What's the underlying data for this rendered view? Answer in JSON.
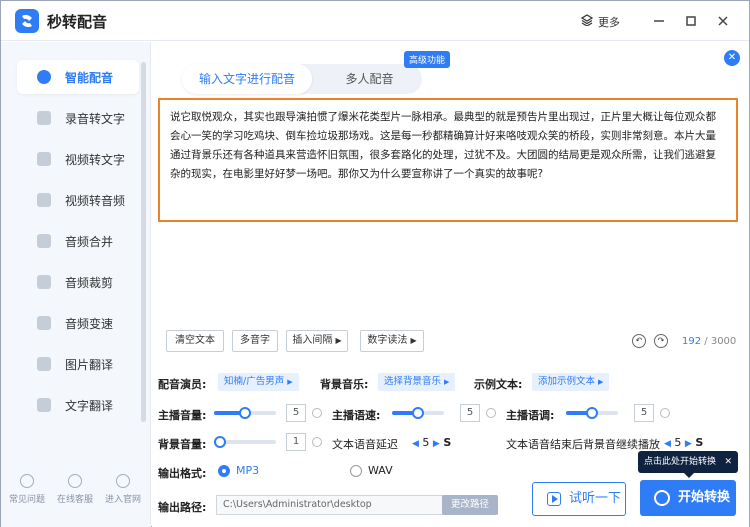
{
  "app": {
    "title": "秒转配音",
    "more_label": "更多"
  },
  "sidebar": {
    "items": [
      {
        "label": "智能配音",
        "active": true
      },
      {
        "label": "录音转文字"
      },
      {
        "label": "视频转文字"
      },
      {
        "label": "视频转音频"
      },
      {
        "label": "音频合并"
      },
      {
        "label": "音频裁剪"
      },
      {
        "label": "音频变速"
      },
      {
        "label": "图片翻译"
      },
      {
        "label": "文字翻译"
      }
    ],
    "footer": [
      {
        "label": "常见问题"
      },
      {
        "label": "在线客服"
      },
      {
        "label": "进入官网"
      }
    ]
  },
  "tabs": [
    {
      "label": "输入文字进行配音",
      "active": true
    },
    {
      "label": "多人配音"
    }
  ],
  "badge": "高级功能",
  "editor": {
    "text": "说它取悦观众，其实也跟导演拍惯了爆米花类型片一脉相承。最典型的就是预告片里出现过，正片里大概让每位观众都会心一笑的学习吃鸡块、倒车捡垃圾那场戏。这是每一秒都精确算计好来咯吱观众笑的桥段，实则非常刻意。本片大量通过背景乐还有各种道具来营造怀旧氛围，很多套路化的处理，过犹不及。大团圆的结局更是观众所需，让我们逃避复杂的现实，在电影里好好梦一场吧。那你又为什么要宣称讲了一个真实的故事呢?"
  },
  "toolbar": {
    "clear": "清空文本",
    "polyphone": "多音字",
    "insert_pause": "插入间隔",
    "digit_read": "数字读法"
  },
  "counter": {
    "current": "192",
    "total": "/ 3000"
  },
  "settings": {
    "voice_label": "配音演员:",
    "voice_value": "知楠/广告男声",
    "bgm_label": "背景音乐:",
    "bgm_value": "选择背景音乐",
    "sample_label": "示例文本:",
    "sample_value": "添加示例文本",
    "volume_label": "主播音量:",
    "volume_value": "5",
    "speed_label": "主播语速:",
    "speed_value": "5",
    "pitch_label": "主播语调:",
    "pitch_value": "5",
    "bg_volume_label": "背景音量:",
    "bg_volume_value": "1",
    "delay_label": "文本语音延迟",
    "delay_value": "5",
    "delay_unit": "S",
    "continue_label": "文本语音结束后背景音继续播放",
    "continue_value": "5",
    "continue_unit": "S",
    "format_label": "输出格式:",
    "format_options": [
      "MP3",
      "WAV"
    ],
    "path_label": "输出路径:",
    "path_value": "C:\\Users\\Administrator\\desktop",
    "change_path": "更改路径"
  },
  "actions": {
    "listen": "试听一下",
    "start": "开始转换",
    "tooltip": "点击此处开始转换"
  },
  "sliders": {
    "volume": 0.5,
    "speed": 0.5,
    "pitch": 0.5,
    "bg_volume": 0.1
  },
  "colors": {
    "accent": "#2f7df6",
    "editor_border": "#e8832a",
    "tooltip_bg": "#0f2240"
  }
}
